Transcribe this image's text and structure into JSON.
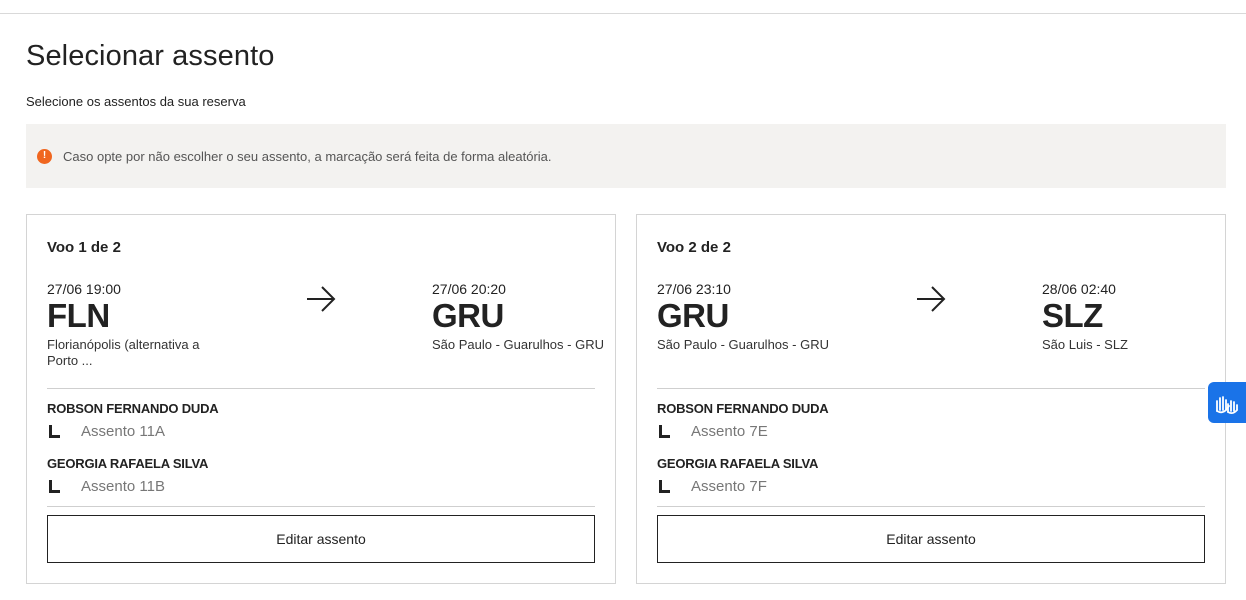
{
  "page": {
    "title": "Selecionar assento",
    "subtitle": "Selecione os assentos da sua reserva"
  },
  "notice": {
    "icon": "exclamation-icon",
    "text": "Caso opte por não escolher o seu assento, a marcação será feita de forma aleatória.",
    "accent_color": "#f0661f"
  },
  "flights": [
    {
      "label": "Voo 1 de 2",
      "origin": {
        "time": "27/06 19:00",
        "code": "FLN",
        "city": "Florianópolis (alternativa a Porto ..."
      },
      "destination": {
        "time": "27/06 20:20",
        "code": "GRU",
        "city": "São Paulo - Guarulhos - GRU"
      },
      "passengers": [
        {
          "name": "ROBSON FERNANDO DUDA",
          "seat": "Assento 11A"
        },
        {
          "name": "GEORGIA RAFAELA SILVA",
          "seat": "Assento 11B"
        }
      ],
      "edit_label": "Editar assento"
    },
    {
      "label": "Voo 2 de 2",
      "origin": {
        "time": "27/06 23:10",
        "code": "GRU",
        "city": "São Paulo - Guarulhos - GRU"
      },
      "destination": {
        "time": "28/06 02:40",
        "code": "SLZ",
        "city": "São Luis - SLZ"
      },
      "passengers": [
        {
          "name": "ROBSON FERNANDO DUDA",
          "seat": "Assento 7E"
        },
        {
          "name": "GEORGIA RAFAELA SILVA",
          "seat": "Assento 7F"
        }
      ],
      "edit_label": "Editar assento"
    }
  ],
  "accessibility": {
    "icon": "sign-language-icon",
    "color": "#1a73e8"
  }
}
